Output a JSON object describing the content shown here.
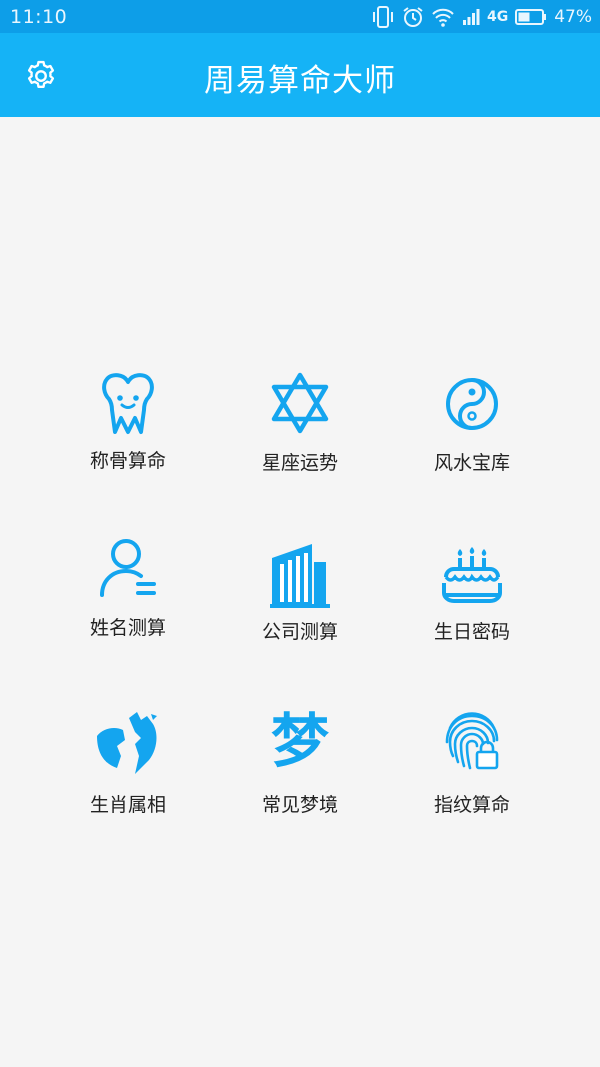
{
  "status_bar": {
    "time": "11:10",
    "network": "4G",
    "battery": "47%"
  },
  "header": {
    "title": "周易算命大师",
    "settings_icon": "gear-icon"
  },
  "theme": {
    "status_bar_bg": "#0d9ee8",
    "header_bg": "#15b3f6",
    "icon_color": "#14a5ef",
    "page_bg": "#f5f5f5"
  },
  "menu": {
    "items": [
      {
        "label": "称骨算命",
        "icon": "tooth-icon"
      },
      {
        "label": "星座运势",
        "icon": "star-of-david-icon"
      },
      {
        "label": "风水宝库",
        "icon": "yin-yang-icon"
      },
      {
        "label": "姓名测算",
        "icon": "person-icon"
      },
      {
        "label": "公司测算",
        "icon": "building-icon"
      },
      {
        "label": "生日密码",
        "icon": "birthday-cake-icon"
      },
      {
        "label": "生肖属相",
        "icon": "zodiac-animal-icon"
      },
      {
        "label": "常见梦境",
        "icon": "dream-icon",
        "icon_text": "梦"
      },
      {
        "label": "指纹算命",
        "icon": "fingerprint-lock-icon"
      }
    ]
  }
}
